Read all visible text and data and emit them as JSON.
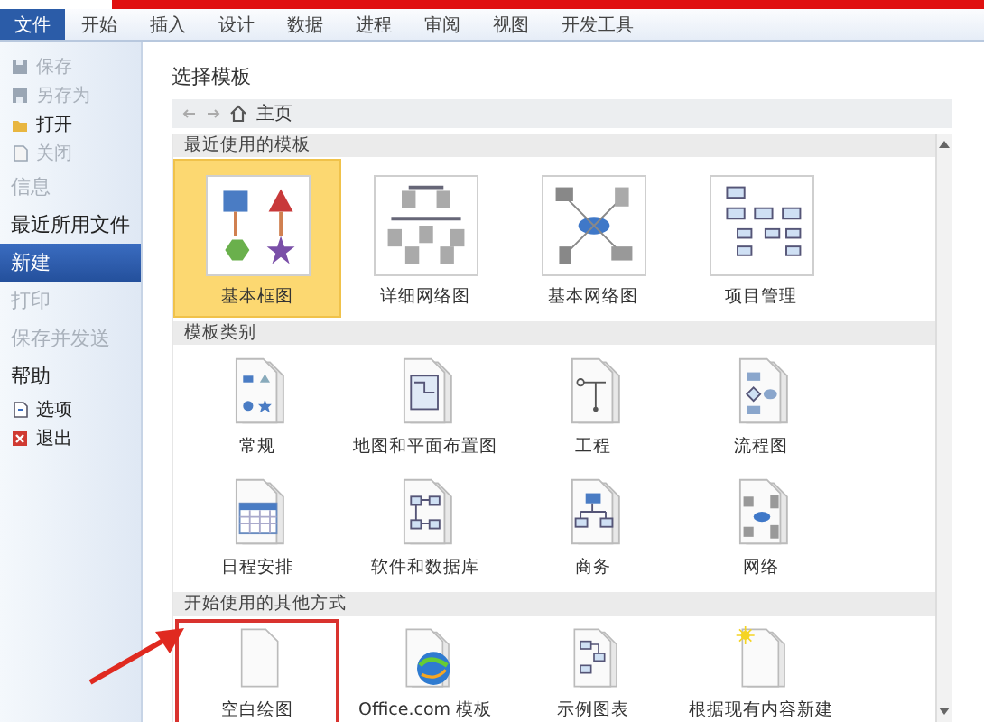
{
  "ribbon_tabs": [
    {
      "label": "文件",
      "selected": true
    },
    {
      "label": "开始",
      "selected": false
    },
    {
      "label": "插入",
      "selected": false
    },
    {
      "label": "设计",
      "selected": false
    },
    {
      "label": "数据",
      "selected": false
    },
    {
      "label": "进程",
      "selected": false
    },
    {
      "label": "审阅",
      "selected": false
    },
    {
      "label": "视图",
      "selected": false
    },
    {
      "label": "开发工具",
      "selected": false
    }
  ],
  "sidebar": {
    "items": [
      {
        "kind": "command",
        "label": "保存",
        "disabled": true,
        "selected": false
      },
      {
        "kind": "command",
        "label": "另存为",
        "disabled": true,
        "selected": false
      },
      {
        "kind": "command",
        "label": "打开",
        "disabled": false,
        "selected": false
      },
      {
        "kind": "command",
        "label": "关闭",
        "disabled": true,
        "selected": false
      },
      {
        "kind": "section",
        "label": "信息",
        "disabled": true,
        "selected": false
      },
      {
        "kind": "section",
        "label": "最近所用文件",
        "disabled": false,
        "selected": false
      },
      {
        "kind": "section",
        "label": "新建",
        "disabled": false,
        "selected": true
      },
      {
        "kind": "section",
        "label": "打印",
        "disabled": true,
        "selected": false
      },
      {
        "kind": "section",
        "label": "保存并发送",
        "disabled": true,
        "selected": false
      },
      {
        "kind": "section",
        "label": "帮助",
        "disabled": false,
        "selected": false
      },
      {
        "kind": "command",
        "label": "选项",
        "disabled": false,
        "selected": false
      },
      {
        "kind": "command",
        "label": "退出",
        "disabled": false,
        "selected": false
      }
    ]
  },
  "main": {
    "title": "选择模板",
    "breadcrumb": {
      "location": "主页"
    },
    "sections": [
      {
        "kind": "recent",
        "header": "最近使用的模板",
        "items": [
          {
            "label": "基本框图",
            "selected": true
          },
          {
            "label": "详细网络图",
            "selected": false
          },
          {
            "label": "基本网络图",
            "selected": false
          },
          {
            "label": "项目管理",
            "selected": false
          }
        ]
      },
      {
        "kind": "category",
        "header": "模板类别",
        "items": [
          {
            "label": "常规"
          },
          {
            "label": "地图和平面布置图"
          },
          {
            "label": "工程"
          },
          {
            "label": "流程图"
          },
          {
            "label": "日程安排"
          },
          {
            "label": "软件和数据库"
          },
          {
            "label": "商务"
          },
          {
            "label": "网络"
          }
        ]
      },
      {
        "kind": "other",
        "header": "开始使用的其他方式",
        "items": [
          {
            "label": "空白绘图",
            "highlighted": true
          },
          {
            "label": "Office.com 模板",
            "highlighted": false
          },
          {
            "label": "示例图表",
            "highlighted": false
          },
          {
            "label": "根据现有内容新建",
            "highlighted": false
          }
        ]
      }
    ]
  }
}
